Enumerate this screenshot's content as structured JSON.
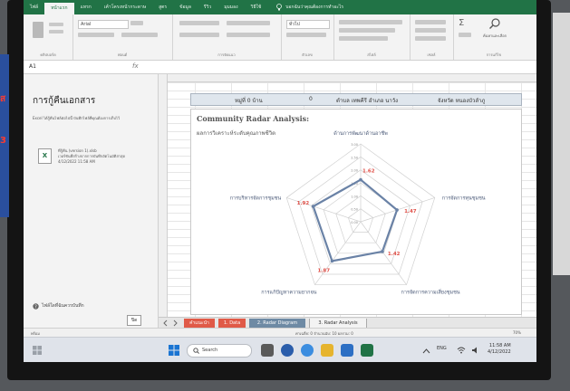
{
  "ribbon": {
    "tabs": [
      "ไฟล์",
      "หน้าแรก",
      "แทรก",
      "เค้าโครงหน้ากระดาษ",
      "สูตร",
      "ข้อมูล",
      "รีวิว",
      "มุมมอง",
      "วิธีใช้"
    ],
    "active_tab_index": 1,
    "tell_me": "บอกฉันว่าคุณต้องการทำอะไร",
    "groups": [
      "คลิปบอร์ด",
      "ฟอนต์",
      "การจัดแนว",
      "ตัวเลข",
      "สไตล์",
      "เซลล์",
      "การแก้ไข"
    ],
    "font_name": "Arial",
    "number_format": "ทั่วไป",
    "find_select": "ค้นหาและเลือก"
  },
  "formula_bar": {
    "name_box": "A1",
    "fx": "fx"
  },
  "documents_pane": {
    "title": "การกู้คืนเอกสาร",
    "description": "Excel ได้กู้คืนไฟล์ต่อไปนี้ บันทึกไฟล์ที่คุณต้องการเก็บไว้",
    "file_lines": [
      "ที่กู้คืน (version 1).xlsb",
      "เวอร์ชันที่สร้างจากการบันทึกอัตโนมัติล่าสุด",
      "4/12/2022 11:58 AM"
    ],
    "help_text": "ไฟล์ใดที่ฉันควรบันทึก",
    "close_label": "ปิด",
    "file_icon_text": "X"
  },
  "sheet_header": {
    "village": "หมู่ที่ 0 บ้าน",
    "number": "0",
    "subdistrict": "ตำบล เทพคีรี อำเภอ นาวัง",
    "province": "จังหวัด หนองบัวลำภู"
  },
  "chart_data": {
    "type": "radar",
    "title": "Community Radar Analysis:",
    "subtitle": "ผลการวิเคราะห์ระดับคุณภาพชีวิต",
    "categories": [
      "ด้านการพัฒนาด้านอาชีพ",
      "การจัดการทุนชุมชน",
      "การจัดการความเสี่ยงชุมชน",
      "การแก้ปัญหาความยากจน",
      "การบริหารจัดการชุมชน"
    ],
    "values": [
      1.62,
      1.47,
      1.42,
      1.87,
      1.92
    ],
    "value_labels": [
      "1.62",
      "1.47",
      "1.42",
      "1.87",
      "1.92"
    ],
    "rlim": [
      0,
      3
    ],
    "ring_ticks": [
      "0.00",
      "0.50",
      "1.00",
      "1.50",
      "2.00",
      "2.50",
      "3.00"
    ],
    "series_color": "#6a82a6",
    "label_color": "#e0524a"
  },
  "sheet_tabs": [
    {
      "label": "คำแนะนำ",
      "color": "#e05a48"
    },
    {
      "label": "1. Data",
      "color": "#e05a48"
    },
    {
      "label": "2. Radar Diagram",
      "color": "#6e8aa4"
    },
    {
      "label": "3. Radar Analysis",
      "color": "#f3f3f3"
    }
  ],
  "status_bar": {
    "left": "พร้อม",
    "stats": "ค่าเฉลี่ย: 0   จำนวนนับ: 10   ผลรวม: 0",
    "zoom": "70%"
  },
  "taskbar": {
    "search": "Search",
    "lang": "ENG",
    "time": "11:58 AM",
    "date": "4/12/2022"
  }
}
